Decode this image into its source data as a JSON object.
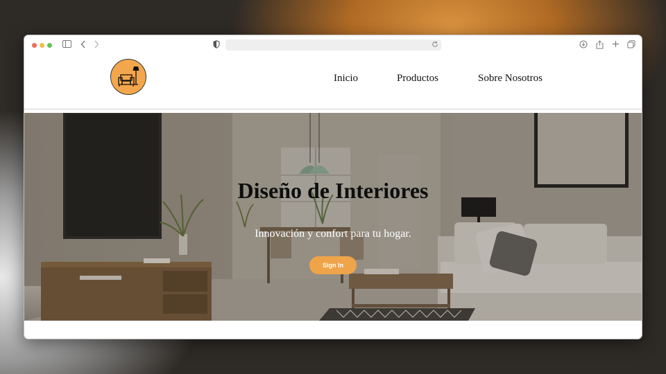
{
  "browser": {
    "traffic_lights": [
      "#ed6a5e",
      "#f4bf4f",
      "#61c554"
    ],
    "url": ""
  },
  "site": {
    "nav": {
      "items": [
        {
          "label": "Inicio"
        },
        {
          "label": "Productos"
        },
        {
          "label": "Sobre Nosotros"
        }
      ]
    },
    "hero": {
      "title": "Diseño de Interiores",
      "subtitle": "Innovación y confort para tu hogar.",
      "cta_label": "Sign In"
    },
    "colors": {
      "accent": "#f0a449",
      "logo_bg": "#f3a64b"
    }
  }
}
